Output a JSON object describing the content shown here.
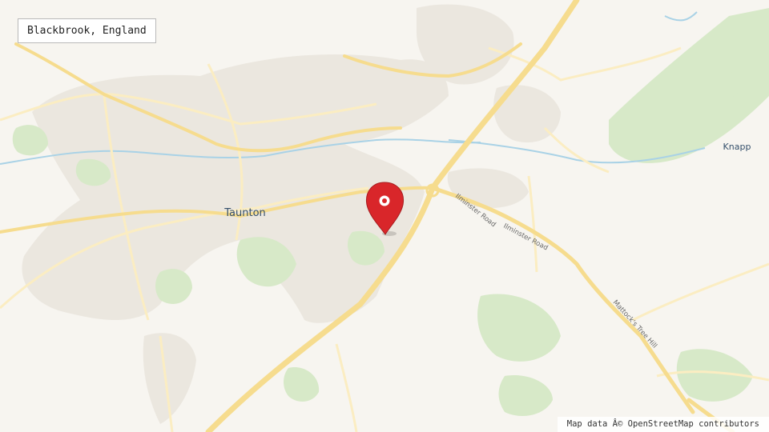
{
  "location": {
    "label": "Blackbrook, England"
  },
  "map": {
    "places": [
      {
        "name": "Taunton"
      },
      {
        "name": "Knapp"
      }
    ],
    "roads": [
      {
        "name": "Ilminster Road"
      },
      {
        "name": "Ilminster Road"
      },
      {
        "name": "Mattock's Tree Hill"
      }
    ],
    "marker": {
      "icon": "map-pin-icon",
      "color": "#d9262a"
    }
  },
  "attribution": "Map data Â© OpenStreetMap contributors",
  "colors": {
    "background": "#f7f5f0",
    "urban": "#ebe7df",
    "green": "#d7e9c8",
    "water": "#a9d2e6",
    "major_road": "#f6dc8e",
    "minor_road": "#fbedc2"
  }
}
